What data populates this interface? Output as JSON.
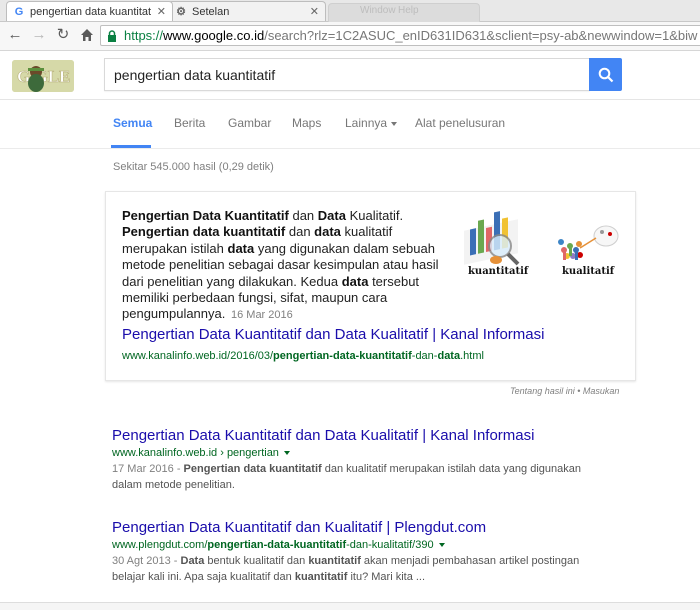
{
  "browser": {
    "tabs": [
      {
        "title": "pengertian data kuantitat",
        "active": true
      },
      {
        "title": "Setelan",
        "active": false
      }
    ],
    "ghost_tabs": [
      "Window",
      "Help"
    ],
    "url": {
      "scheme": "https://",
      "host": "www.google.co.id",
      "path": "/search?rlz=1C2ASUC_enID631ID631&sclient=psy-ab&newwindow=1&biw"
    }
  },
  "search": {
    "query": "pengertian data kuantitatif",
    "logo_text": "GOOGLE"
  },
  "nav": {
    "items": [
      {
        "label": "Semua",
        "active": true
      },
      {
        "label": "Berita"
      },
      {
        "label": "Gambar"
      },
      {
        "label": "Maps"
      },
      {
        "label": "Lainnya"
      },
      {
        "label": "Alat penelusuran"
      }
    ]
  },
  "stats": "Sekitar 545.000 hasil (0,29 detik)",
  "snippet": {
    "text_parts": [
      {
        "t": "Pengertian Data Kuantitatif",
        "b": true
      },
      {
        "t": " dan ",
        "b": false
      },
      {
        "t": "Data",
        "b": true
      },
      {
        "t": " Kualitatif. ",
        "b": false
      },
      {
        "t": "Pengertian data kuantitatif",
        "b": true
      },
      {
        "t": " dan ",
        "b": false
      },
      {
        "t": "data",
        "b": true
      },
      {
        "t": " kualitatif merupakan istilah ",
        "b": false
      },
      {
        "t": "data",
        "b": true
      },
      {
        "t": " yang digunakan dalam sebuah metode penelitian sebagai dasar kesimpulan atau hasil dari penelitian yang dilakukan. Kedua ",
        "b": false
      },
      {
        "t": "data",
        "b": true
      },
      {
        "t": " tersebut memiliki perbedaan fungsi, sifat, maupun cara pengumpulannya.",
        "b": false
      }
    ],
    "date": "16 Mar 2016",
    "link_title": "Pengertian Data Kuantitatif dan Data Kualitatif | Kanal Informasi",
    "url_parts": [
      {
        "t": "www.kanalinfo.web.id/2016/03/",
        "b": false
      },
      {
        "t": "pengertian-data-kuantitatif",
        "b": true
      },
      {
        "t": "-dan-",
        "b": false
      },
      {
        "t": "data",
        "b": true
      },
      {
        "t": ".html",
        "b": false
      }
    ],
    "images": [
      {
        "caption": "kuantitatif"
      },
      {
        "caption": "kualitatif"
      }
    ]
  },
  "about_text": "Tentang hasil ini • Masukan",
  "results": [
    {
      "title": "Pengertian Data Kuantitatif dan Data Kualitatif | Kanal Informasi",
      "url_parts": [
        {
          "t": "www.kanalinfo.web.id › pengertian",
          "b": false
        }
      ],
      "desc_parts": [
        {
          "t": "17 Mar 2016 - ",
          "b": false,
          "d": true
        },
        {
          "t": "Pengertian data kuantitatif",
          "b": true
        },
        {
          "t": " dan kualitatif merupakan istilah data yang digunakan dalam metode penelitian.",
          "b": false
        }
      ]
    },
    {
      "title": "Pengertian Data Kuantitatif dan Kualitatif | Plengdut.com",
      "url_parts": [
        {
          "t": "www.plengdut.com/",
          "b": false
        },
        {
          "t": "pengertian-data-kuantitatif",
          "b": true
        },
        {
          "t": "-dan-kualitatif/390",
          "b": false
        }
      ],
      "desc_parts": [
        {
          "t": "30 Agt 2013 - ",
          "b": false,
          "d": true
        },
        {
          "t": "Data",
          "b": true
        },
        {
          "t": " bentuk kualitatif dan ",
          "b": false
        },
        {
          "t": "kuantitatif",
          "b": true
        },
        {
          "t": " akan menjadi pembahasan artikel postingan belajar kali ini. Apa saja kualitatif dan ",
          "b": false
        },
        {
          "t": "kuantitatif",
          "b": true
        },
        {
          "t": " itu? Mari kita ...",
          "b": false
        }
      ]
    }
  ],
  "colors": {
    "accent": "#4285f4",
    "link": "#1a0dab",
    "url_green": "#006621",
    "text": "#222222",
    "muted": "#808080"
  }
}
